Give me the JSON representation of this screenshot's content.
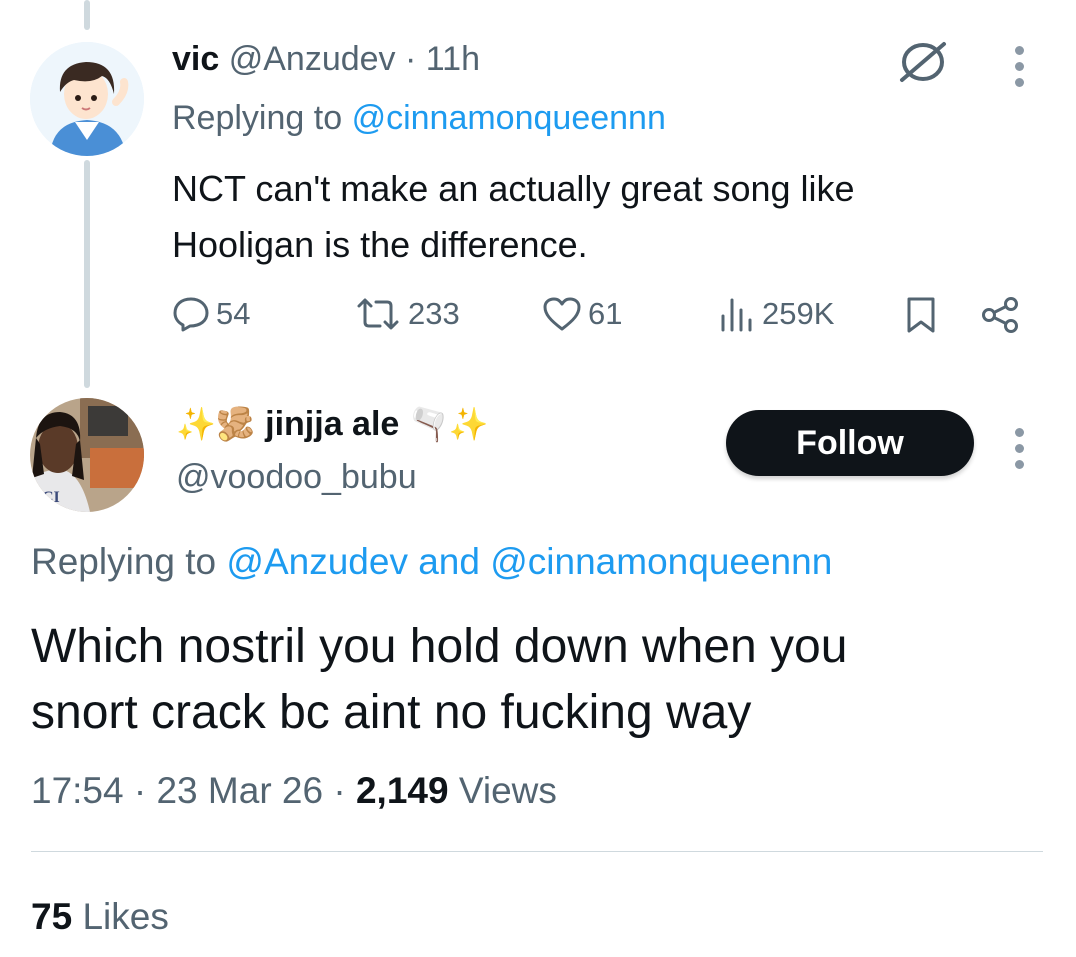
{
  "reply_tweet": {
    "display_name": "vic",
    "handle": "@Anzudev",
    "separator": "·",
    "time": "11h",
    "replying_label": "Replying to",
    "replying_to": "@cinnamonqueennn",
    "text_line1": "NCT can't make an actually great song like",
    "text_line2": "Hooligan is the difference.",
    "metrics": {
      "replies": "54",
      "retweets": "233",
      "likes": "61",
      "views": "259K"
    }
  },
  "main_tweet": {
    "display_name": "jinjja ale",
    "name_emoji_left": "✨🫚",
    "name_emoji_right": "🫗✨",
    "handle": "@voodoo_bubu",
    "follow_label": "Follow",
    "replying_label": "Replying to",
    "replying_to_1": "@Anzudev",
    "replying_and": "and",
    "replying_to_2": "@cinnamonqueennn",
    "text_line1": "Which nostril you hold down when you",
    "text_line2": "snort crack bc aint no fucking way",
    "time": "17:54",
    "date": "23 Mar 26",
    "views_count": "2,149",
    "views_label": "Views",
    "likes_count": "75",
    "likes_label": "Likes"
  },
  "icons": {
    "grok": "grok-slash-icon",
    "more": "more-vertical-icon",
    "reply": "reply-icon",
    "retweet": "retweet-icon",
    "like": "heart-icon",
    "views": "views-bar-icon",
    "bookmark": "bookmark-icon",
    "share": "share-icon"
  },
  "colors": {
    "link": "#1d9bf0",
    "secondary": "#536471",
    "text": "#0f1419",
    "follow_bg": "#0f1419"
  }
}
